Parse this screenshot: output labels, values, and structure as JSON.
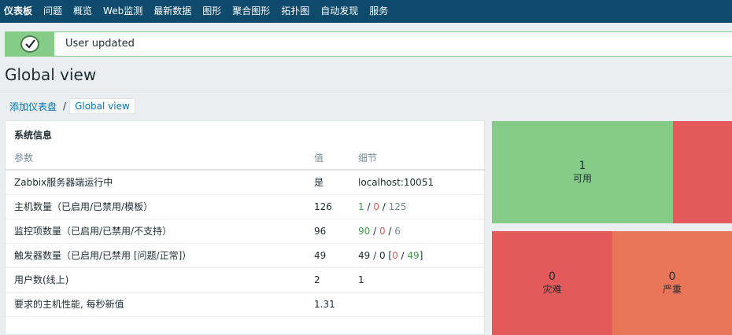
{
  "nav": {
    "items": [
      "仪表板",
      "问题",
      "概览",
      "Web监测",
      "最新数据",
      "图形",
      "聚合图形",
      "拓扑图",
      "自动发现",
      "服务"
    ]
  },
  "message": {
    "text": "User updated"
  },
  "page": {
    "title": "Global view"
  },
  "breadcrumb": {
    "parent": "添加仪表盘",
    "separator": "/",
    "current": "Global view"
  },
  "system_info": {
    "title": "系统信息",
    "headers": {
      "param": "参数",
      "value": "值",
      "detail": "细节"
    },
    "rows": [
      {
        "param": "Zabbix服务器端运行中",
        "value": "是",
        "detail": "localhost:10051"
      },
      {
        "param": "主机数量（已启用/已禁用/模板）",
        "value": "126",
        "d1": "1",
        "d2": "0",
        "d3": "125"
      },
      {
        "param": "监控项数量（已启用/已禁用/不支持）",
        "value": "96",
        "d1": "90",
        "d2": "0",
        "d3": "6"
      },
      {
        "param": "触发器数量（已启用/已禁用 [问题/正常]）",
        "value": "49",
        "d1": "49",
        "d2": "0",
        "d3": "0",
        "d4": "49"
      },
      {
        "param": "用户数(线上)",
        "value": "2",
        "detail": "1"
      },
      {
        "param": "要求的主机性能, 每秒新值",
        "value": "1.31",
        "detail": ""
      }
    ]
  },
  "tiles": [
    {
      "count": "1",
      "label": "可用",
      "color": "#86cc89"
    },
    {
      "count": "",
      "label": "",
      "color": "#e45959"
    },
    {
      "count": "0",
      "label": "灾难",
      "color": "#e45959"
    },
    {
      "count": "0",
      "label": "严重",
      "color": "#e97659"
    }
  ],
  "colors": {
    "nav_bg": "#0e4a6b",
    "success": "#86cc89",
    "link": "#0275b8",
    "ok": "#429e47",
    "problem": "#e45959"
  }
}
